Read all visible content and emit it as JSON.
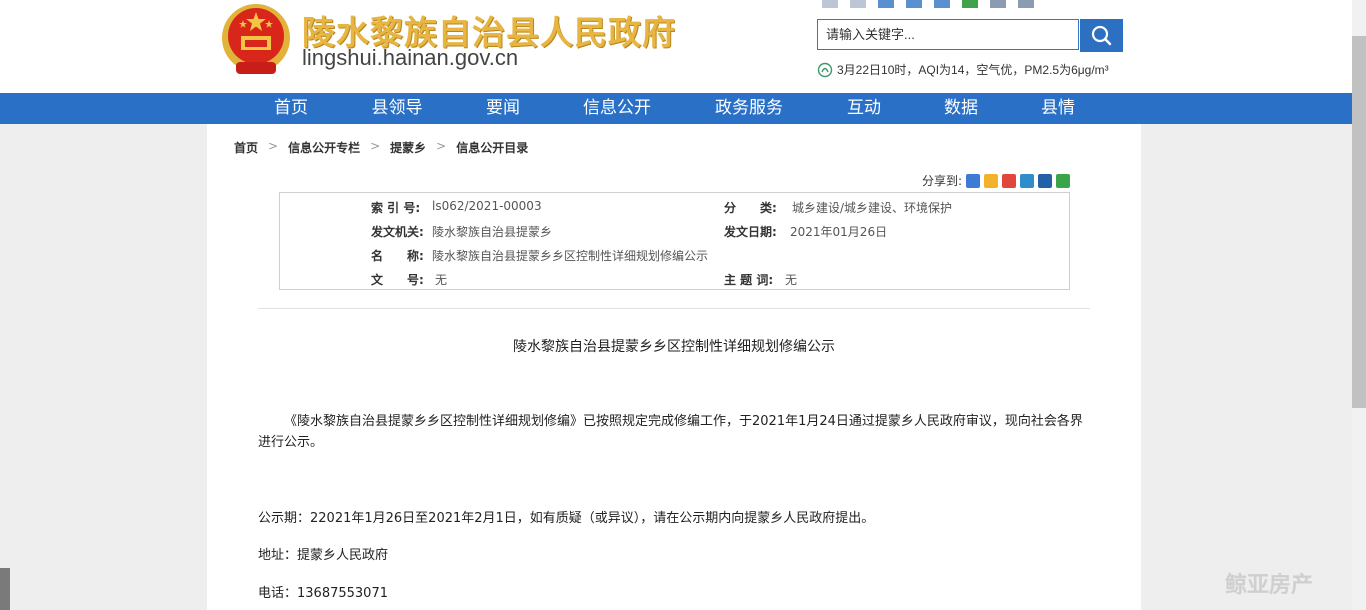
{
  "header": {
    "site_name": "陵水黎族自治县人民政府",
    "site_domain": "lingshui.hainan.gov.cn",
    "search_placeholder": "请输入关键字...",
    "weather": "3月22日10时，AQI为14，空气优，PM2.5为6μg/m³"
  },
  "nav": {
    "items": [
      "首页",
      "县领导",
      "要闻",
      "信息公开",
      "政务服务",
      "互动",
      "数据",
      "县情"
    ]
  },
  "breadcrumb": [
    "首页",
    "信息公开专栏",
    "提蒙乡",
    "信息公开目录"
  ],
  "breadcrumb_separator": ">",
  "share": {
    "label": "分享到:"
  },
  "meta": {
    "index_label": "索 引 号:",
    "index_value": "ls062/2021-00003",
    "category_label": "分　　类:",
    "category_value": "城乡建设/城乡建设、环境保护",
    "issuer_label": "发文机关:",
    "issuer_value": "陵水黎族自治县提蒙乡",
    "date_label": "发文日期:",
    "date_value": "2021年01月26日",
    "name_label": "名　　称:",
    "name_value": "陵水黎族自治县提蒙乡乡区控制性详细规划修编公示",
    "docno_label": "文　　号:",
    "docno_value": "无",
    "subject_label": "主 题 词:",
    "subject_value": "无"
  },
  "article": {
    "title": "陵水黎族自治县提蒙乡乡区控制性详细规划修编公示",
    "para1": "《陵水黎族自治县提蒙乡乡区控制性详细规划修编》已按照规定完成修编工作，于2021年1月24日通过提蒙乡人民政府审议，现向社会各界进行公示。",
    "para2": "公示期：22021年1月26日至2021年2月1日，如有质疑（或异议），请在公示期内向提蒙乡人民政府提出。",
    "para3": "地址：提蒙乡人民政府",
    "para4": "电话：13687553071"
  },
  "colors": {
    "nav": "#2a70c6",
    "title_gold": "#e7b542",
    "emblem_red": "#d8261b"
  },
  "watermark": "鲸亚房产"
}
